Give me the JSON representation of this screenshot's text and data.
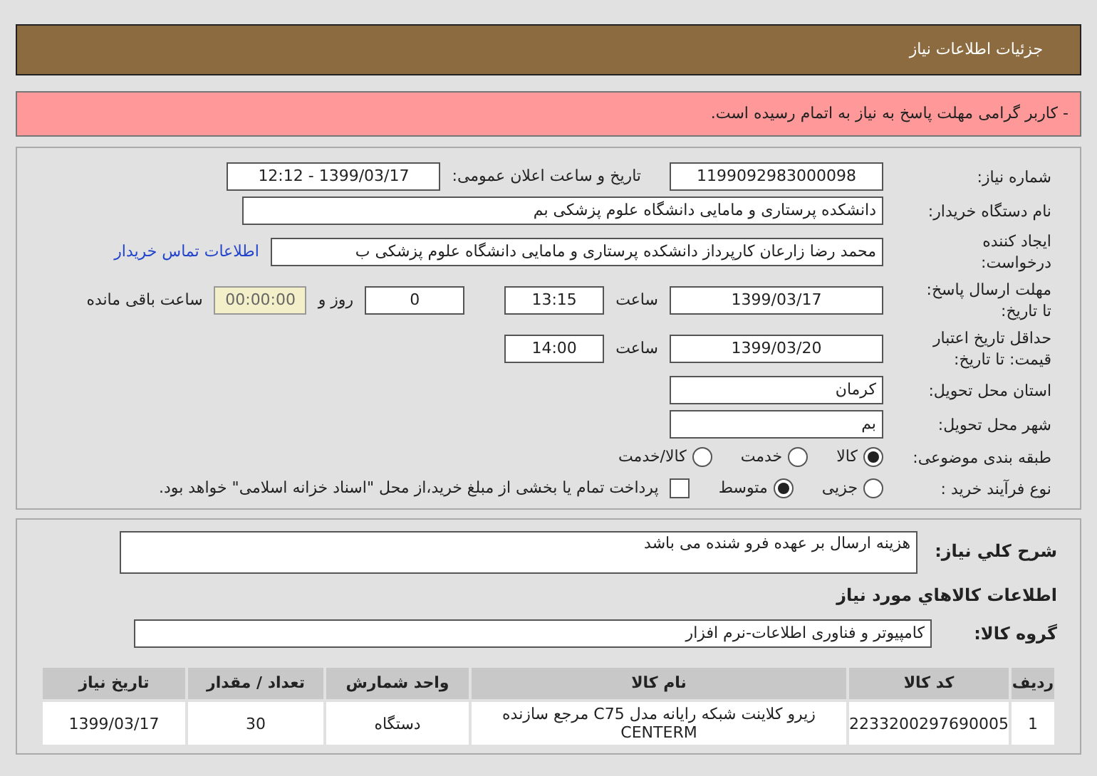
{
  "header": {
    "title": "جزئیات اطلاعات نیاز"
  },
  "alert": {
    "text": "- کاربر گرامی مهلت پاسخ به نیاز به اتمام رسیده است."
  },
  "need_number": {
    "label": "شماره نیاز:",
    "value": "1199092983000098"
  },
  "announce": {
    "label": "تاریخ و ساعت اعلان عمومی:",
    "value": "1399/03/17 - 12:12"
  },
  "buyer_org": {
    "label": "نام دستگاه خریدار:",
    "value": "دانشکده پرستاری و مامایی دانشگاه علوم پزشکی بم"
  },
  "requester": {
    "label": "ایجاد کننده درخواست:",
    "value": "محمد رضا  زارعان  کارپرداز دانشکده پرستاری و مامایی دانشگاه علوم پزشکی ب",
    "link": "اطلاعات تماس خریدار"
  },
  "deadline": {
    "label": "مهلت ارسال پاسخ: تا تاریخ:",
    "date": "1399/03/17",
    "time_label": "ساعت",
    "time": "13:15",
    "days": "0",
    "days_label": "روز و",
    "remaining": "00:00:00",
    "remaining_label": "ساعت باقی مانده"
  },
  "validity": {
    "label": "حداقل تاریخ اعتبار قیمت: تا تاریخ:",
    "date": "1399/03/20",
    "time_label": "ساعت",
    "time": "14:00"
  },
  "province": {
    "label": "استان محل تحویل:",
    "value": "کرمان"
  },
  "city": {
    "label": "شهر محل تحویل:",
    "value": "بم"
  },
  "category": {
    "label": "طبقه بندی موضوعی:",
    "options": [
      {
        "label": "کالا",
        "selected": true
      },
      {
        "label": "خدمت",
        "selected": false
      },
      {
        "label": "کالا/خدمت",
        "selected": false
      }
    ]
  },
  "process": {
    "label": "نوع فرآیند خرید :",
    "options": [
      {
        "label": "جزیی",
        "selected": false
      },
      {
        "label": "متوسط",
        "selected": true
      }
    ],
    "checkbox": {
      "label": "پرداخت تمام یا بخشی از مبلغ خرید،از محل \"اسناد خزانه اسلامی\" خواهد بود.",
      "checked": false
    }
  },
  "description": {
    "label": "شرح کلي نياز:",
    "value": "هزینه ارسال بر عهده فرو شنده می باشد"
  },
  "goods_title": "اطلاعات کالاهاي مورد نياز",
  "group": {
    "label": "گروه کالا:",
    "value": "کامپیوتر و فناوری اطلاعات-نرم افزار"
  },
  "table": {
    "columns": [
      "ردیف",
      "کد کالا",
      "نام کالا",
      "واحد شمارش",
      "تعداد / مقدار",
      "تاریخ نیاز"
    ],
    "rows": [
      [
        "1",
        "2233200297690005",
        "زیرو کلاینت شبکه رایانه مدل C75 مرجع سازنده CENTERM",
        "دستگاه",
        "30",
        "1399/03/17"
      ]
    ]
  }
}
